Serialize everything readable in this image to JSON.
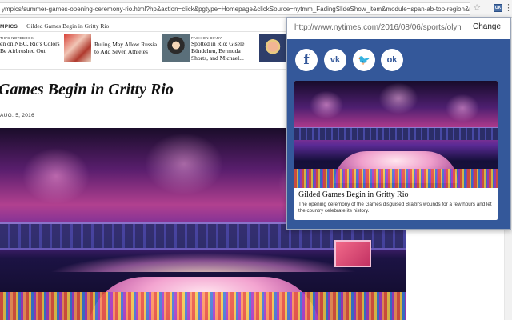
{
  "browser": {
    "url": "ympics/summer-games-opening-ceremony-rio.html?hp&action=click&pgtype=Homepage&clickSource=nytmm_FadingSlideShow_item&module=span-ab-top-region&region=top-news...",
    "extension_label": "OK"
  },
  "article": {
    "section": "MPICS",
    "breadcrumb": "Gilded Games Begin in Gritty Rio",
    "related": [
      {
        "kicker": "TIC'S NOTEBOOK",
        "headline": "en on NBC, Rio's Colors Be Airbrushed Out"
      },
      {
        "kicker": "",
        "headline": "Ruling May Allow Russia to Add Seven Athletes"
      },
      {
        "kicker": "FASHION DIARY",
        "headline": "Spotted in Rio: Gisele Bündchen, Bermuda Shorts, and Michael..."
      }
    ],
    "headline": "Games Begin in Gritty Rio",
    "date": "AUG. 5, 2016"
  },
  "popup": {
    "url": "http://www.nytimes.com/2016/08/06/sports/olympi",
    "change_label": "Change",
    "share_buttons": [
      {
        "name": "facebook",
        "glyph": "f"
      },
      {
        "name": "vk",
        "glyph": "vk"
      },
      {
        "name": "twitter",
        "glyph": "🐦"
      },
      {
        "name": "odnoklassniki",
        "glyph": "ok"
      }
    ],
    "card": {
      "title": "Gilded Games Begin in Gritty Rio",
      "description": "The opening ceremony of the Games disguised Brazil's wounds for a few hours and let the country celebrate its history."
    },
    "accent_color": "#34589a"
  }
}
